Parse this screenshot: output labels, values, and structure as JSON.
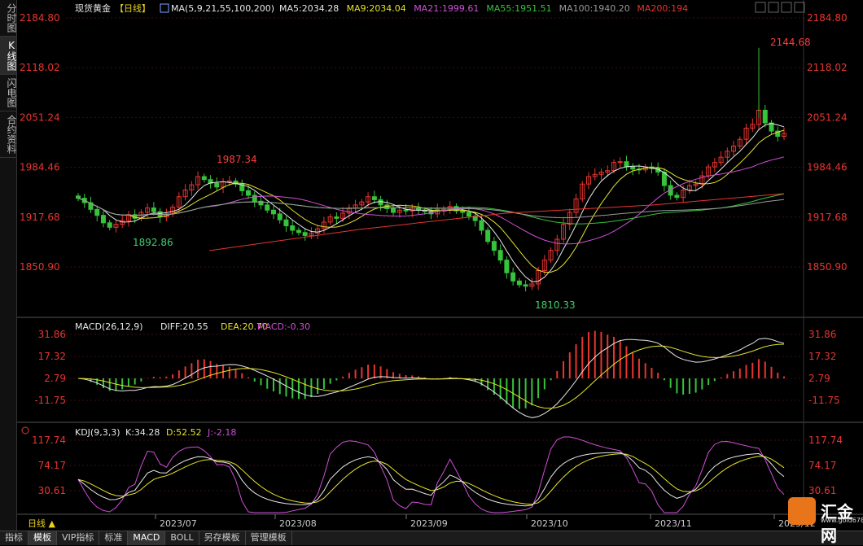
{
  "sidebar": {
    "tabs": [
      {
        "label": "分时图",
        "active": false
      },
      {
        "label": "K线图",
        "active": true
      },
      {
        "label": "闪电图",
        "active": false
      },
      {
        "label": "合约资料",
        "active": false
      }
    ]
  },
  "header": {
    "title": "现货黄金",
    "period": "【日线】",
    "ma_label": "MA(5,9,21,55,100,200)",
    "ma_values": [
      {
        "label": "MA5:2034.28",
        "color": "#e8e8e8"
      },
      {
        "label": "MA9:2034.04",
        "color": "#e5e22a"
      },
      {
        "label": "MA21:1999.61",
        "color": "#d14fd8"
      },
      {
        "label": "MA55:1951.51",
        "color": "#35c43b"
      },
      {
        "label": "MA100:1940.20",
        "color": "#9a9a9a"
      },
      {
        "label": "MA200:194",
        "color": "#e8352f"
      }
    ]
  },
  "macd": {
    "label": "MACD(26,12,9)",
    "diff": "DIFF:20.55",
    "dea": "DEA:20.70",
    "macd": "MACD:-0.30"
  },
  "kdj": {
    "label": "KDJ(9,3,3)",
    "k": "K:34.28",
    "d": "D:52.52",
    "j": "J:-2.18"
  },
  "xaxis": {
    "period_label": "日线 ▲",
    "months": [
      "2023/07",
      "2023/08",
      "2023/09",
      "2023/10",
      "2023/11",
      "2023/12"
    ]
  },
  "bottombar": {
    "tabs": [
      {
        "label": "指标",
        "active": false
      },
      {
        "label": "模板",
        "active": true
      },
      {
        "label": "VIP指标",
        "active": false
      },
      {
        "label": "标准",
        "active": false
      },
      {
        "label": "MACD",
        "active": true
      },
      {
        "label": "BOLL",
        "active": false
      },
      {
        "label": "另存模板",
        "active": false
      },
      {
        "label": "管理模板",
        "active": false
      }
    ]
  },
  "logo": {
    "text": "汇金网",
    "url": "www.gold678.com"
  },
  "colors": {
    "up": "#e8352f",
    "down": "#35c43b",
    "axis_label": "#e8352f",
    "grid": "#3a1010"
  },
  "chart_data": [
    {
      "type": "candlestick",
      "title": "现货黄金 日线",
      "ylim": [
        1810.33,
        2184.8
      ],
      "yticks": [
        2184.8,
        2118.02,
        2051.24,
        1984.46,
        1917.68,
        1850.9
      ],
      "annotations": [
        {
          "text": "1987.34",
          "value": 1987.34
        },
        {
          "text": "1892.86",
          "value": 1892.86
        },
        {
          "text": "1810.33",
          "value": 1810.33
        },
        {
          "text": "2144.68",
          "value": 2144.68
        }
      ],
      "closes": [
        1943,
        1937,
        1928,
        1920,
        1910,
        1904,
        1908,
        1913,
        1921,
        1916,
        1924,
        1930,
        1925,
        1918,
        1922,
        1931,
        1945,
        1954,
        1961,
        1972,
        1968,
        1963,
        1958,
        1965,
        1966,
        1962,
        1953,
        1947,
        1939,
        1934,
        1927,
        1922,
        1914,
        1906,
        1900,
        1897,
        1893,
        1896,
        1902,
        1911,
        1918,
        1916,
        1923,
        1930,
        1934,
        1938,
        1945,
        1941,
        1934,
        1929,
        1924,
        1927,
        1926,
        1930,
        1927,
        1925,
        1922,
        1928,
        1928,
        1932,
        1926,
        1924,
        1919,
        1913,
        1900,
        1885,
        1873,
        1860,
        1843,
        1832,
        1827,
        1825,
        1828,
        1846,
        1860,
        1873,
        1888,
        1908,
        1924,
        1942,
        1962,
        1972,
        1975,
        1978,
        1980,
        1991,
        1992,
        1985,
        1982,
        1981,
        1985,
        1983,
        1978,
        1960,
        1947,
        1944,
        1954,
        1960,
        1962,
        1973,
        1985,
        1991,
        1998,
        2006,
        2013,
        2022,
        2037,
        2042,
        2061,
        2044,
        2033,
        2026,
        2030
      ],
      "ma_series": [
        {
          "name": "MA5",
          "last": 2034.28
        },
        {
          "name": "MA9",
          "last": 2034.04
        },
        {
          "name": "MA21",
          "last": 1999.61
        },
        {
          "name": "MA55",
          "last": 1951.51
        },
        {
          "name": "MA100",
          "last": 1940.2
        },
        {
          "name": "MA200",
          "last": 194
        }
      ]
    },
    {
      "type": "bar",
      "title": "MACD(26,12,9)",
      "yticks": [
        31.86,
        17.32,
        2.79,
        -11.75
      ],
      "last": {
        "DIFF": 20.55,
        "DEA": 20.7,
        "MACD": -0.3
      }
    },
    {
      "type": "line",
      "title": "KDJ(9,3,3)",
      "yticks": [
        117.74,
        74.17,
        30.61
      ],
      "last": {
        "K": 34.28,
        "D": 52.52,
        "J": -2.18
      }
    }
  ]
}
